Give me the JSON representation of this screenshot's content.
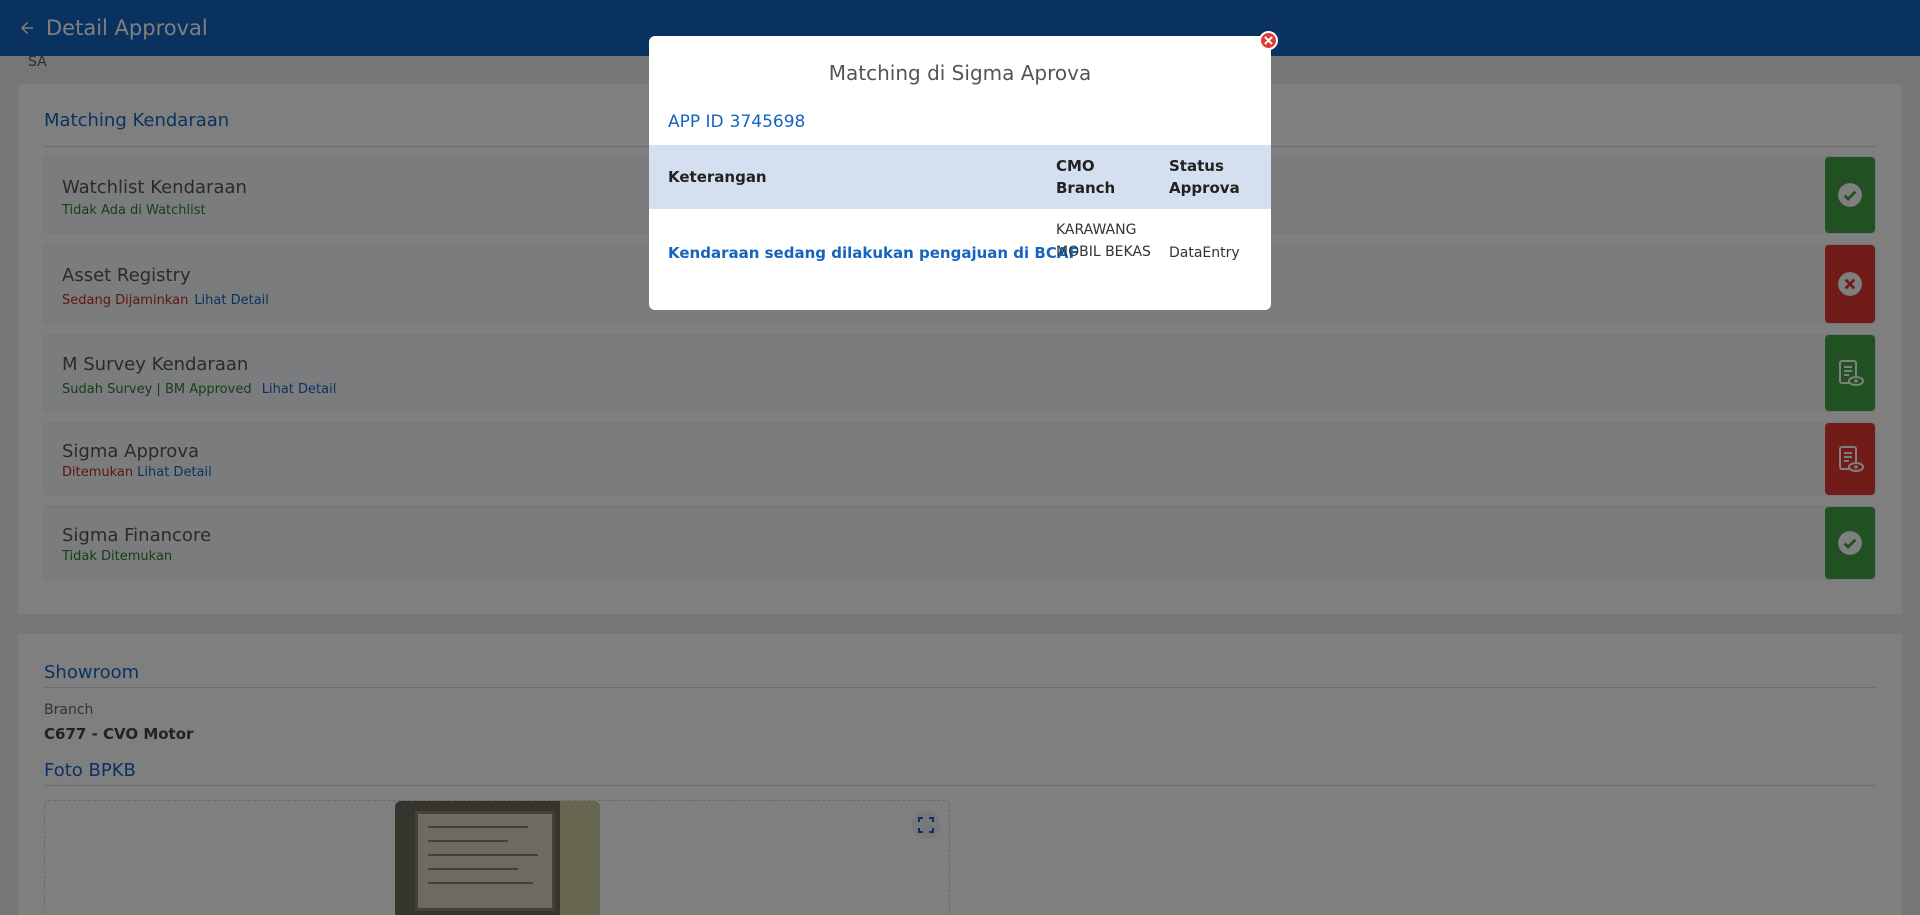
{
  "header": {
    "title": "Detail Approval",
    "back_icon": "arrow-left-icon"
  },
  "sa_label": "SA",
  "matching": {
    "title": "Matching Kendaraan",
    "rows": [
      {
        "title": "Watchlist Kendaraan",
        "status": "Tidak Ada di Watchlist",
        "status_color": "green",
        "link": "",
        "icon": "check-circle-icon",
        "button_color": "green"
      },
      {
        "title": "Asset Registry",
        "status": "Sedang Dijaminkan",
        "status_color": "red",
        "link": "Lihat Detail",
        "icon": "x-circle-icon",
        "button_color": "red"
      },
      {
        "title": "M Survey Kendaraan",
        "status": "Sudah Survey | BM Approved",
        "status_color": "green",
        "link": "Lihat Detail",
        "icon": "document-view-icon",
        "button_color": "green"
      },
      {
        "title": "Sigma Approva",
        "status": "Ditemukan",
        "status_color": "red",
        "link": "Lihat Detail",
        "icon": "document-view-icon",
        "button_color": "red"
      },
      {
        "title": "Sigma Financore",
        "status": "Tidak Ditemukan",
        "status_color": "green",
        "link": "",
        "icon": "check-circle-icon",
        "button_color": "green"
      }
    ]
  },
  "showroom": {
    "title": "Showroom",
    "branch_label": "Branch",
    "branch_value": "C677 - CVO Motor"
  },
  "foto_bpkb": {
    "title": "Foto BPKB"
  },
  "modal": {
    "title": "Matching di Sigma Aprova",
    "app_id_label": "APP ID",
    "app_id_value": "3745698",
    "columns": {
      "keterangan": "Keterangan",
      "cmo_branch": "CMO Branch",
      "status": "Status Approva"
    },
    "rows": [
      {
        "keterangan": "Kendaraan sedang dilakukan pengajuan di BCAF",
        "cmo_branch": "KARAWANG MOBIL BEKAS",
        "status": "DataEntry"
      }
    ]
  },
  "colors": {
    "primary": "#1565c0",
    "success": "#43a047",
    "danger": "#e53935"
  }
}
